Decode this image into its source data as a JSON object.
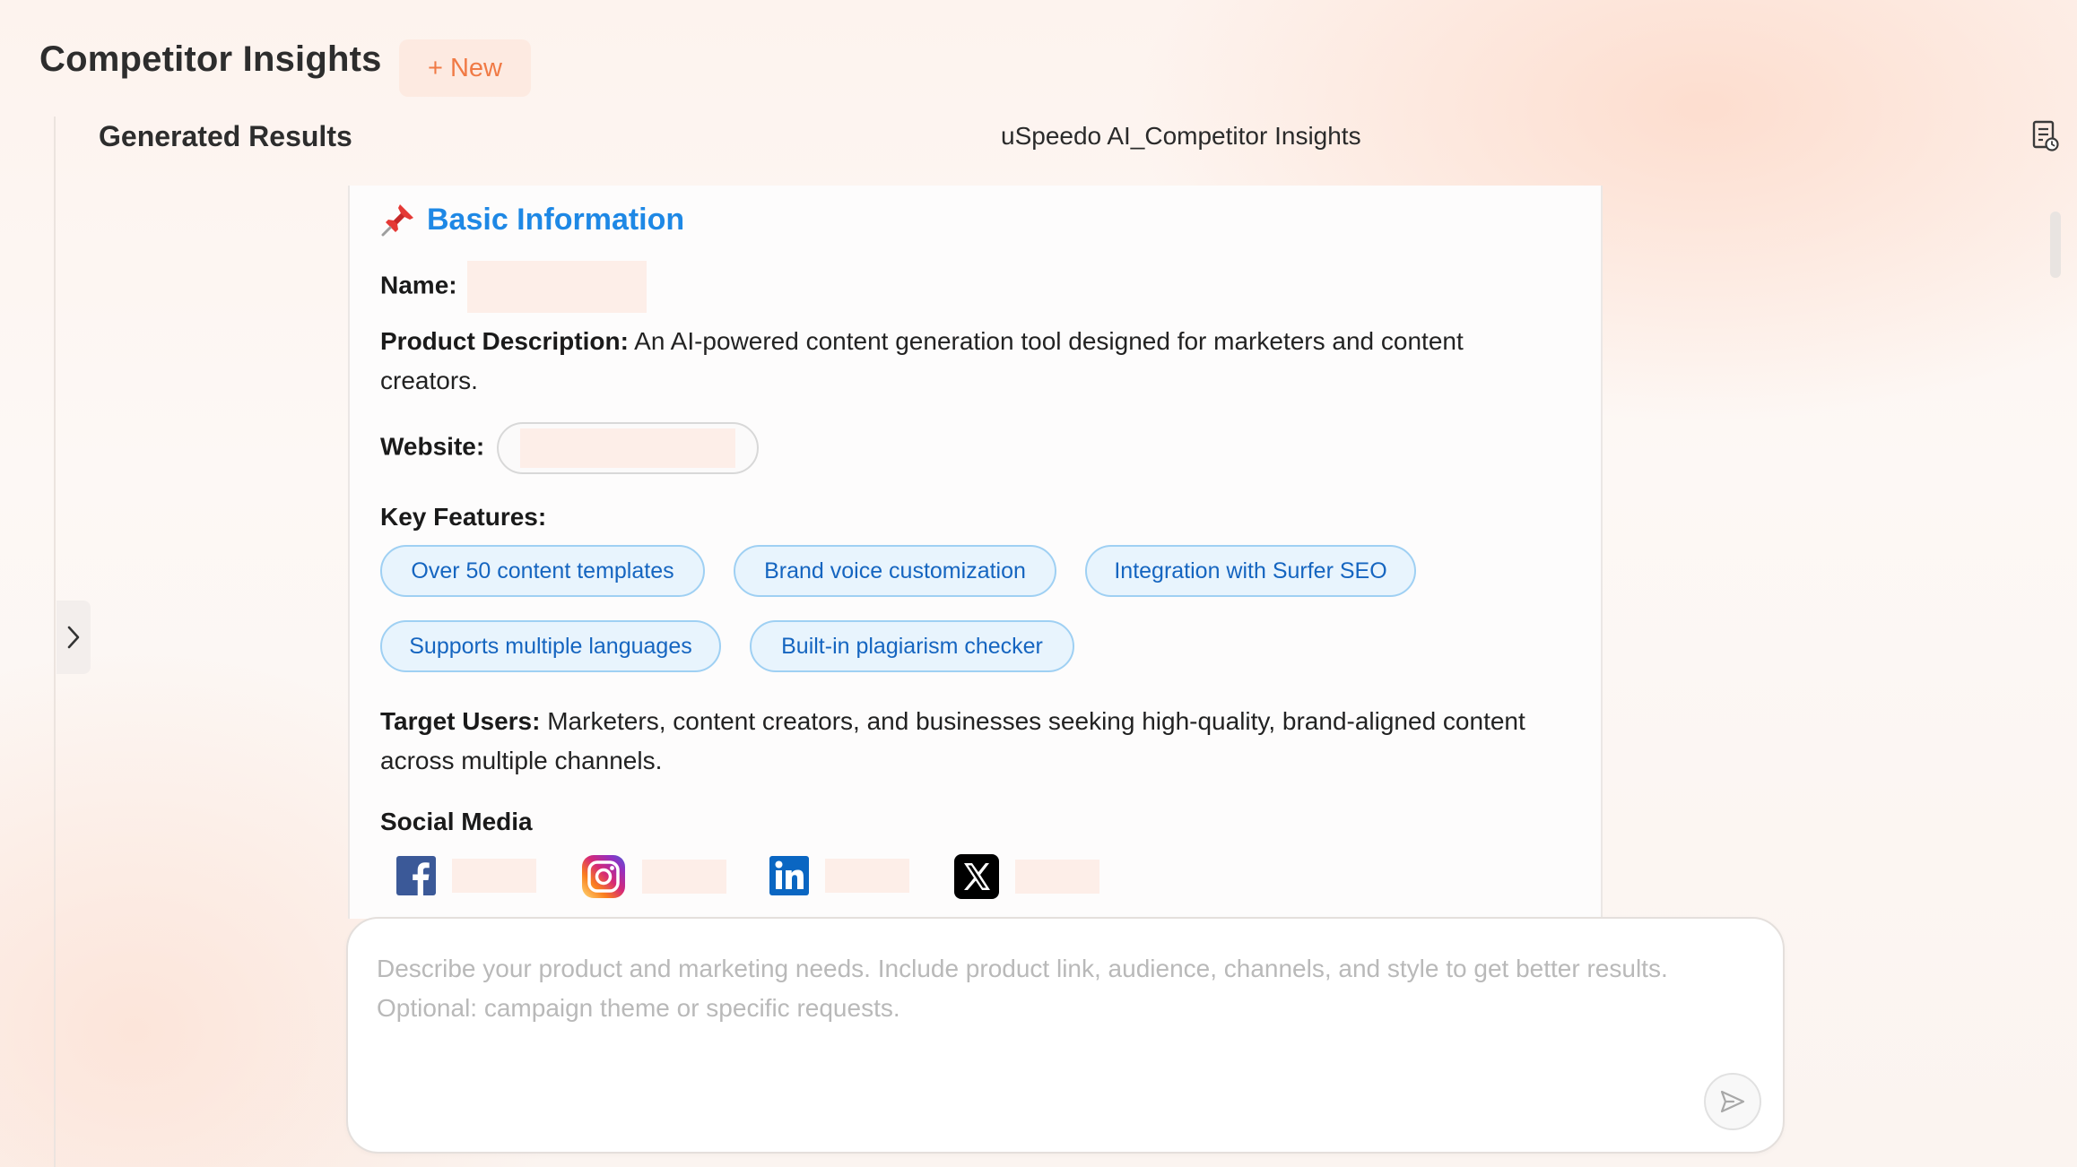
{
  "app": {
    "title": "Competitor Insights",
    "new_button": {
      "plus": "+",
      "label": "New"
    }
  },
  "panel": {
    "section_title": "Generated Results",
    "document_title": "uSpeedo AI_Competitor Insights"
  },
  "report": {
    "heading": "Basic Information",
    "name_label": "Name:",
    "description_label": "Product Description:",
    "description_text": "An AI-powered content generation tool designed for marketers and content creators.",
    "website_label": "Website:",
    "key_features_label": "Key Features:",
    "key_features": [
      "Over 50 content templates",
      "Brand voice customization",
      "Integration with Surfer SEO",
      "Supports multiple languages",
      "Built-in plagiarism checker"
    ],
    "target_users_label": "Target Users:",
    "target_users_text": "Marketers, content creators, and businesses seeking high-quality, brand-aligned content across multiple channels.",
    "social_media_label": "Social Media",
    "social_icons": [
      "facebook-icon",
      "instagram-icon",
      "linkedin-icon",
      "x-icon"
    ]
  },
  "composer": {
    "placeholder": "Describe your product and marketing needs. Include product link, audience, channels, and style to get better results.\nOptional: campaign theme or specific requests."
  },
  "colors": {
    "accent": "#f07a45",
    "heading_blue": "#1e88e5",
    "chip_bg": "#e8f4fd",
    "chip_border": "#9fd0f3",
    "chip_text": "#1565c0",
    "redaction": "#fdeee8"
  }
}
